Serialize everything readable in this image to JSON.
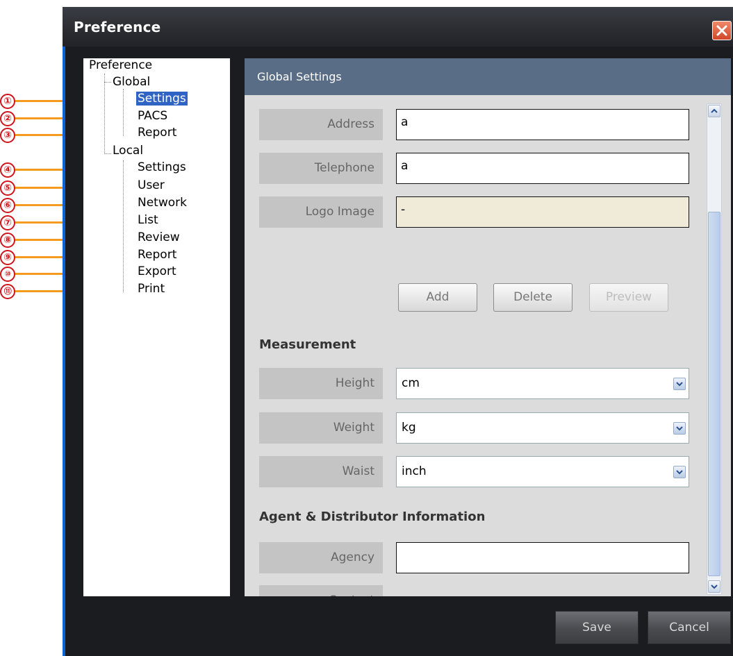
{
  "window": {
    "title": "Preference",
    "close_icon": "close-icon"
  },
  "tree": {
    "root": "Preference",
    "global": {
      "label": "Global",
      "items": [
        "Settings",
        "PACS",
        "Report"
      ]
    },
    "local": {
      "label": "Local",
      "items": [
        "Settings",
        "User",
        "Network",
        "List",
        "Review",
        "Report",
        "Export",
        "Print"
      ]
    },
    "selected": "Settings"
  },
  "callouts": [
    "①",
    "②",
    "③",
    "④",
    "⑤",
    "⑥",
    "⑦",
    "⑧",
    "⑨",
    "⑩",
    "⑪"
  ],
  "panel": {
    "header": "Global Settings",
    "fields": {
      "address": {
        "label": "Address",
        "value": "a"
      },
      "telephone": {
        "label": "Telephone",
        "value": "a"
      },
      "logo": {
        "label": "Logo Image",
        "value": "-"
      }
    },
    "logo_buttons": {
      "add": "Add",
      "delete": "Delete",
      "preview": "Preview"
    },
    "measurement": {
      "title": "Measurement",
      "height": {
        "label": "Height",
        "value": "cm"
      },
      "weight": {
        "label": "Weight",
        "value": "kg"
      },
      "waist": {
        "label": "Waist",
        "value": "inch"
      }
    },
    "agent": {
      "title": "Agent & Distributor Information",
      "agency": {
        "label": "Agency",
        "value": ""
      },
      "contact": {
        "label": "Contact",
        "value": ""
      }
    }
  },
  "footer": {
    "save": "Save",
    "cancel": "Cancel"
  },
  "colors": {
    "accent_orange": "#f39a1f",
    "callout_red": "#d0141c",
    "header_blue": "#5a6d86",
    "selection": "#2f63c4"
  }
}
